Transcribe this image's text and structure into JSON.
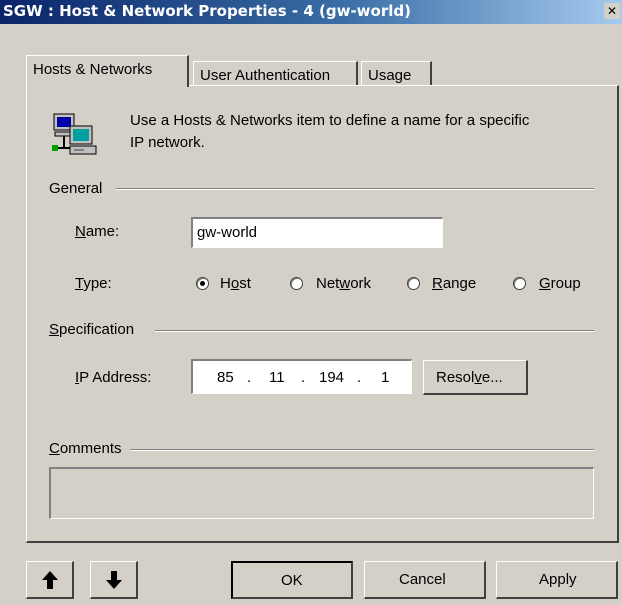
{
  "window": {
    "title": "SGW : Host & Network Properties - 4 (gw-world)",
    "close_glyph": "✕"
  },
  "tabs": [
    {
      "label": "Hosts & Networks",
      "active": true
    },
    {
      "label": "User Authentication",
      "active": false
    },
    {
      "label": "Usage",
      "active": false
    }
  ],
  "intro": {
    "icon": "network-computers-icon",
    "line1": "Use a Hosts & Networks item to define a name for a specific",
    "line2": "IP network."
  },
  "general": {
    "heading": "General",
    "name_label_u": "N",
    "name_label_rest": "ame:",
    "name_value": "gw-world",
    "type_label_u": "T",
    "type_label_rest": "ype:",
    "type_options": [
      {
        "pre": "H",
        "u": "o",
        "post": "st",
        "checked": true
      },
      {
        "pre": "Net",
        "u": "w",
        "post": "ork",
        "checked": false
      },
      {
        "pre": "",
        "u": "R",
        "post": "ange",
        "checked": false
      },
      {
        "pre": "",
        "u": "G",
        "post": "roup",
        "checked": false
      }
    ]
  },
  "specification": {
    "heading_u": "S",
    "heading_rest": "pecification",
    "ip_label_u": "I",
    "ip_label_rest": "P Address:",
    "ip_octets": [
      "85",
      "11",
      "194",
      "1"
    ],
    "ip_dot": ".",
    "resolve_pre": "Resol",
    "resolve_u": "v",
    "resolve_post": "e..."
  },
  "comments": {
    "heading_u": "C",
    "heading_rest": "omments",
    "value": ""
  },
  "footer": {
    "up_glyph": "🡅",
    "down_glyph": "🡇",
    "ok": "OK",
    "cancel": "Cancel",
    "apply": "Apply"
  }
}
